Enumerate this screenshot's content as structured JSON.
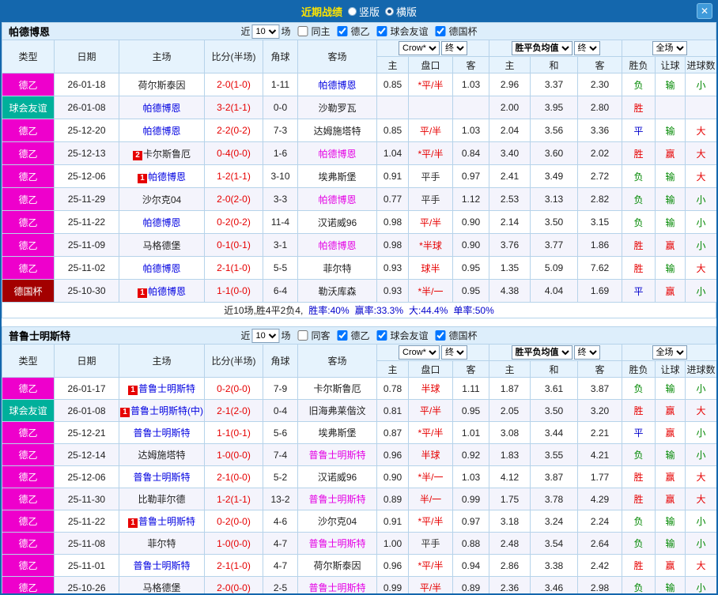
{
  "topbar": {
    "title": "近期战绩",
    "vertical_label": "竖版",
    "horizontal_label": "横版",
    "close_glyph": "✕"
  },
  "filter_labels": {
    "near": "近",
    "count": "10",
    "matches": "场"
  },
  "table_headers": {
    "type": "类型",
    "date": "日期",
    "home": "主场",
    "score": "比分(半场)",
    "corner": "角球",
    "away": "客场",
    "odds_company_select": "Crow*",
    "final_select": "终",
    "mean_select": "胜平负均值",
    "full_select": "全场",
    "odds_home": "主",
    "odds_handicap": "盘口",
    "odds_away": "客",
    "mean_home": "主",
    "mean_draw": "和",
    "mean_away": "客",
    "result_wdl": "胜负",
    "result_handicap": "让球",
    "result_goals": "进球数"
  },
  "colors": {
    "league2": "#ee00cc",
    "friendly": "#00b09b",
    "cup": "#a30000",
    "focus_home_blue": "#0000e0",
    "focus_away_magenta": "#e400e4",
    "win_red": "#e60000",
    "draw_blue": "#0000cc",
    "loss_green": "#008800",
    "topbar_blue": "#1467ad",
    "title_yellow": "#ffe400"
  },
  "sections": [
    {
      "team": "帕德博恩",
      "filters": [
        {
          "label": "同主",
          "checked": false
        },
        {
          "label": "德乙",
          "checked": true
        },
        {
          "label": "球会友谊",
          "checked": true
        },
        {
          "label": "德国杯",
          "checked": true
        }
      ],
      "rows": [
        {
          "type": "德乙",
          "type_color": "#ee00cc",
          "date": "26-01-18",
          "home_badge": "",
          "home": "荷尔斯泰因",
          "home_color": "#222222",
          "score": "2-0(1-0)",
          "corner": "1-11",
          "away_badge": "",
          "away": "帕德博恩",
          "away_color": "#0000e0",
          "odds_home": "0.85",
          "handicap": "*平/半",
          "handicap_color": "#e60000",
          "odds_away": "1.03",
          "mean_home": "2.96",
          "mean_draw": "3.37",
          "mean_away": "2.30",
          "res_wdl": "负",
          "res_wdl_color": "#008800",
          "res_hcp": "输",
          "res_hcp_color": "#008800",
          "res_goal": "小",
          "res_goal_color": "#008800"
        },
        {
          "type": "球会友谊",
          "type_color": "#00b09b",
          "date": "26-01-08",
          "home_badge": "",
          "home": "帕德博恩",
          "home_color": "#0000e0",
          "score": "3-2(1-1)",
          "corner": "0-0",
          "away_badge": "",
          "away": "沙勒罗瓦",
          "away_color": "#222222",
          "odds_home": "",
          "handicap": "",
          "handicap_color": "#e60000",
          "odds_away": "",
          "mean_home": "2.00",
          "mean_draw": "3.95",
          "mean_away": "2.80",
          "res_wdl": "胜",
          "res_wdl_color": "#e60000",
          "res_hcp": "",
          "res_hcp_color": "#008800",
          "res_goal": "",
          "res_goal_color": "#008800"
        },
        {
          "type": "德乙",
          "type_color": "#ee00cc",
          "date": "25-12-20",
          "home_badge": "",
          "home": "帕德博恩",
          "home_color": "#0000e0",
          "score": "2-2(0-2)",
          "corner": "7-3",
          "away_badge": "",
          "away": "达姆施塔特",
          "away_color": "#222222",
          "odds_home": "0.85",
          "handicap": "平/半",
          "handicap_color": "#e60000",
          "odds_away": "1.03",
          "mean_home": "2.04",
          "mean_draw": "3.56",
          "mean_away": "3.36",
          "res_wdl": "平",
          "res_wdl_color": "#0000cc",
          "res_hcp": "输",
          "res_hcp_color": "#008800",
          "res_goal": "大",
          "res_goal_color": "#e60000"
        },
        {
          "type": "德乙",
          "type_color": "#ee00cc",
          "date": "25-12-13",
          "home_badge": "2",
          "home": "卡尔斯鲁厄",
          "home_color": "#222222",
          "score": "0-4(0-0)",
          "corner": "1-6",
          "away_badge": "",
          "away": "帕德博恩",
          "away_color": "#e400e4",
          "odds_home": "1.04",
          "handicap": "*平/半",
          "handicap_color": "#e60000",
          "odds_away": "0.84",
          "mean_home": "3.40",
          "mean_draw": "3.60",
          "mean_away": "2.02",
          "res_wdl": "胜",
          "res_wdl_color": "#e60000",
          "res_hcp": "赢",
          "res_hcp_color": "#e60000",
          "res_goal": "大",
          "res_goal_color": "#e60000"
        },
        {
          "type": "德乙",
          "type_color": "#ee00cc",
          "date": "25-12-06",
          "home_badge": "1",
          "home": "帕德博恩",
          "home_color": "#0000e0",
          "score": "1-2(1-1)",
          "corner": "3-10",
          "away_badge": "",
          "away": "埃弗斯堡",
          "away_color": "#222222",
          "odds_home": "0.91",
          "handicap": "平手",
          "handicap_color": "#333333",
          "odds_away": "0.97",
          "mean_home": "2.41",
          "mean_draw": "3.49",
          "mean_away": "2.72",
          "res_wdl": "负",
          "res_wdl_color": "#008800",
          "res_hcp": "输",
          "res_hcp_color": "#008800",
          "res_goal": "大",
          "res_goal_color": "#e60000"
        },
        {
          "type": "德乙",
          "type_color": "#ee00cc",
          "date": "25-11-29",
          "home_badge": "",
          "home": "沙尔克04",
          "home_color": "#222222",
          "score": "2-0(2-0)",
          "corner": "3-3",
          "away_badge": "",
          "away": "帕德博恩",
          "away_color": "#e400e4",
          "odds_home": "0.77",
          "handicap": "平手",
          "handicap_color": "#333333",
          "odds_away": "1.12",
          "mean_home": "2.53",
          "mean_draw": "3.13",
          "mean_away": "2.82",
          "res_wdl": "负",
          "res_wdl_color": "#008800",
          "res_hcp": "输",
          "res_hcp_color": "#008800",
          "res_goal": "小",
          "res_goal_color": "#008800"
        },
        {
          "type": "德乙",
          "type_color": "#ee00cc",
          "date": "25-11-22",
          "home_badge": "",
          "home": "帕德博恩",
          "home_color": "#0000e0",
          "score": "0-2(0-2)",
          "corner": "11-4",
          "away_badge": "",
          "away": "汉诺威96",
          "away_color": "#222222",
          "odds_home": "0.98",
          "handicap": "平/半",
          "handicap_color": "#e60000",
          "odds_away": "0.90",
          "mean_home": "2.14",
          "mean_draw": "3.50",
          "mean_away": "3.15",
          "res_wdl": "负",
          "res_wdl_color": "#008800",
          "res_hcp": "输",
          "res_hcp_color": "#008800",
          "res_goal": "小",
          "res_goal_color": "#008800"
        },
        {
          "type": "德乙",
          "type_color": "#ee00cc",
          "date": "25-11-09",
          "home_badge": "",
          "home": "马格德堡",
          "home_color": "#222222",
          "score": "0-1(0-1)",
          "corner": "3-1",
          "away_badge": "",
          "away": "帕德博恩",
          "away_color": "#e400e4",
          "odds_home": "0.98",
          "handicap": "*半球",
          "handicap_color": "#e60000",
          "odds_away": "0.90",
          "mean_home": "3.76",
          "mean_draw": "3.77",
          "mean_away": "1.86",
          "res_wdl": "胜",
          "res_wdl_color": "#e60000",
          "res_hcp": "赢",
          "res_hcp_color": "#e60000",
          "res_goal": "小",
          "res_goal_color": "#008800"
        },
        {
          "type": "德乙",
          "type_color": "#ee00cc",
          "date": "25-11-02",
          "home_badge": "",
          "home": "帕德博恩",
          "home_color": "#0000e0",
          "score": "2-1(1-0)",
          "corner": "5-5",
          "away_badge": "",
          "away": "菲尔特",
          "away_color": "#222222",
          "odds_home": "0.93",
          "handicap": "球半",
          "handicap_color": "#e60000",
          "odds_away": "0.95",
          "mean_home": "1.35",
          "mean_draw": "5.09",
          "mean_away": "7.62",
          "res_wdl": "胜",
          "res_wdl_color": "#e60000",
          "res_hcp": "输",
          "res_hcp_color": "#008800",
          "res_goal": "大",
          "res_goal_color": "#e60000"
        },
        {
          "type": "德国杯",
          "type_color": "#a30000",
          "date": "25-10-30",
          "home_badge": "1",
          "home": "帕德博恩",
          "home_color": "#0000e0",
          "score": "1-1(0-0)",
          "corner": "6-4",
          "away_badge": "",
          "away": "勒沃库森",
          "away_color": "#222222",
          "odds_home": "0.93",
          "handicap": "*半/一",
          "handicap_color": "#e60000",
          "odds_away": "0.95",
          "mean_home": "4.38",
          "mean_draw": "4.04",
          "mean_away": "1.69",
          "res_wdl": "平",
          "res_wdl_color": "#0000cc",
          "res_hcp": "赢",
          "res_hcp_color": "#e60000",
          "res_goal": "小",
          "res_goal_color": "#008800"
        }
      ],
      "footer": [
        {
          "text": "近10场,胜4平2负4,",
          "color": "#222222"
        },
        {
          "text": "胜率:40%",
          "color": "#0000cc"
        },
        {
          "text": "赢率:33.3%",
          "color": "#0000cc"
        },
        {
          "text": "大:44.4%",
          "color": "#0000cc"
        },
        {
          "text": "单率:50%",
          "color": "#0000cc"
        }
      ]
    },
    {
      "team": "普鲁士明斯特",
      "filters": [
        {
          "label": "同客",
          "checked": false
        },
        {
          "label": "德乙",
          "checked": true
        },
        {
          "label": "球会友谊",
          "checked": true
        },
        {
          "label": "德国杯",
          "checked": true
        }
      ],
      "rows": [
        {
          "type": "德乙",
          "type_color": "#ee00cc",
          "date": "26-01-17",
          "home_badge": "1",
          "home": "普鲁士明斯特",
          "home_color": "#0000e0",
          "score": "0-2(0-0)",
          "corner": "7-9",
          "away_badge": "",
          "away": "卡尔斯鲁厄",
          "away_color": "#222222",
          "odds_home": "0.78",
          "handicap": "半球",
          "handicap_color": "#e60000",
          "odds_away": "1.11",
          "mean_home": "1.87",
          "mean_draw": "3.61",
          "mean_away": "3.87",
          "res_wdl": "负",
          "res_wdl_color": "#008800",
          "res_hcp": "输",
          "res_hcp_color": "#008800",
          "res_goal": "小",
          "res_goal_color": "#008800"
        },
        {
          "type": "球会友谊",
          "type_color": "#00b09b",
          "date": "26-01-08",
          "home_badge": "1",
          "home": "普鲁士明斯特(中)",
          "home_color": "#0000e0",
          "score": "2-1(2-0)",
          "corner": "0-4",
          "away_badge": "",
          "away": "旧海弗莱偕汶",
          "away_color": "#222222",
          "odds_home": "0.81",
          "handicap": "平/半",
          "handicap_color": "#e60000",
          "odds_away": "0.95",
          "mean_home": "2.05",
          "mean_draw": "3.50",
          "mean_away": "3.20",
          "res_wdl": "胜",
          "res_wdl_color": "#e60000",
          "res_hcp": "赢",
          "res_hcp_color": "#e60000",
          "res_goal": "大",
          "res_goal_color": "#e60000"
        },
        {
          "type": "德乙",
          "type_color": "#ee00cc",
          "date": "25-12-21",
          "home_badge": "",
          "home": "普鲁士明斯特",
          "home_color": "#0000e0",
          "score": "1-1(0-1)",
          "corner": "5-6",
          "away_badge": "",
          "away": "埃弗斯堡",
          "away_color": "#222222",
          "odds_home": "0.87",
          "handicap": "*平/半",
          "handicap_color": "#e60000",
          "odds_away": "1.01",
          "mean_home": "3.08",
          "mean_draw": "3.44",
          "mean_away": "2.21",
          "res_wdl": "平",
          "res_wdl_color": "#0000cc",
          "res_hcp": "赢",
          "res_hcp_color": "#e60000",
          "res_goal": "小",
          "res_goal_color": "#008800"
        },
        {
          "type": "德乙",
          "type_color": "#ee00cc",
          "date": "25-12-14",
          "home_badge": "",
          "home": "达姆施塔特",
          "home_color": "#222222",
          "score": "1-0(0-0)",
          "corner": "7-4",
          "away_badge": "",
          "away": "普鲁士明斯特",
          "away_color": "#e400e4",
          "odds_home": "0.96",
          "handicap": "半球",
          "handicap_color": "#e60000",
          "odds_away": "0.92",
          "mean_home": "1.83",
          "mean_draw": "3.55",
          "mean_away": "4.21",
          "res_wdl": "负",
          "res_wdl_color": "#008800",
          "res_hcp": "输",
          "res_hcp_color": "#008800",
          "res_goal": "小",
          "res_goal_color": "#008800"
        },
        {
          "type": "德乙",
          "type_color": "#ee00cc",
          "date": "25-12-06",
          "home_badge": "",
          "home": "普鲁士明斯特",
          "home_color": "#0000e0",
          "score": "2-1(0-0)",
          "corner": "5-2",
          "away_badge": "",
          "away": "汉诺威96",
          "away_color": "#222222",
          "odds_home": "0.90",
          "handicap": "*半/一",
          "handicap_color": "#e60000",
          "odds_away": "1.03",
          "mean_home": "4.12",
          "mean_draw": "3.87",
          "mean_away": "1.77",
          "res_wdl": "胜",
          "res_wdl_color": "#e60000",
          "res_hcp": "赢",
          "res_hcp_color": "#e60000",
          "res_goal": "大",
          "res_goal_color": "#e60000"
        },
        {
          "type": "德乙",
          "type_color": "#ee00cc",
          "date": "25-11-30",
          "home_badge": "",
          "home": "比勒菲尔德",
          "home_color": "#222222",
          "score": "1-2(1-1)",
          "corner": "13-2",
          "away_badge": "",
          "away": "普鲁士明斯特",
          "away_color": "#e400e4",
          "odds_home": "0.89",
          "handicap": "半/一",
          "handicap_color": "#e60000",
          "odds_away": "0.99",
          "mean_home": "1.75",
          "mean_draw": "3.78",
          "mean_away": "4.29",
          "res_wdl": "胜",
          "res_wdl_color": "#e60000",
          "res_hcp": "赢",
          "res_hcp_color": "#e60000",
          "res_goal": "大",
          "res_goal_color": "#e60000"
        },
        {
          "type": "德乙",
          "type_color": "#ee00cc",
          "date": "25-11-22",
          "home_badge": "1",
          "home": "普鲁士明斯特",
          "home_color": "#0000e0",
          "score": "0-2(0-0)",
          "corner": "4-6",
          "away_badge": "",
          "away": "沙尔克04",
          "away_color": "#222222",
          "odds_home": "0.91",
          "handicap": "*平/半",
          "handicap_color": "#e60000",
          "odds_away": "0.97",
          "mean_home": "3.18",
          "mean_draw": "3.24",
          "mean_away": "2.24",
          "res_wdl": "负",
          "res_wdl_color": "#008800",
          "res_hcp": "输",
          "res_hcp_color": "#008800",
          "res_goal": "小",
          "res_goal_color": "#008800"
        },
        {
          "type": "德乙",
          "type_color": "#ee00cc",
          "date": "25-11-08",
          "home_badge": "",
          "home": "菲尔特",
          "home_color": "#222222",
          "score": "1-0(0-0)",
          "corner": "4-7",
          "away_badge": "",
          "away": "普鲁士明斯特",
          "away_color": "#e400e4",
          "odds_home": "1.00",
          "handicap": "平手",
          "handicap_color": "#333333",
          "odds_away": "0.88",
          "mean_home": "2.48",
          "mean_draw": "3.54",
          "mean_away": "2.64",
          "res_wdl": "负",
          "res_wdl_color": "#008800",
          "res_hcp": "输",
          "res_hcp_color": "#008800",
          "res_goal": "小",
          "res_goal_color": "#008800"
        },
        {
          "type": "德乙",
          "type_color": "#ee00cc",
          "date": "25-11-01",
          "home_badge": "",
          "home": "普鲁士明斯特",
          "home_color": "#0000e0",
          "score": "2-1(1-0)",
          "corner": "4-7",
          "away_badge": "",
          "away": "荷尔斯泰因",
          "away_color": "#222222",
          "odds_home": "0.96",
          "handicap": "*平/半",
          "handicap_color": "#e60000",
          "odds_away": "0.94",
          "mean_home": "2.86",
          "mean_draw": "3.38",
          "mean_away": "2.42",
          "res_wdl": "胜",
          "res_wdl_color": "#e60000",
          "res_hcp": "赢",
          "res_hcp_color": "#e60000",
          "res_goal": "大",
          "res_goal_color": "#e60000"
        },
        {
          "type": "德乙",
          "type_color": "#ee00cc",
          "date": "25-10-26",
          "home_badge": "",
          "home": "马格德堡",
          "home_color": "#222222",
          "score": "2-0(0-0)",
          "corner": "2-5",
          "away_badge": "",
          "away": "普鲁士明斯特",
          "away_color": "#e400e4",
          "odds_home": "0.99",
          "handicap": "平/半",
          "handicap_color": "#e60000",
          "odds_away": "0.89",
          "mean_home": "2.36",
          "mean_draw": "3.46",
          "mean_away": "2.98",
          "res_wdl": "负",
          "res_wdl_color": "#008800",
          "res_hcp": "输",
          "res_hcp_color": "#008800",
          "res_goal": "小",
          "res_goal_color": "#008800"
        }
      ],
      "footer": []
    }
  ]
}
